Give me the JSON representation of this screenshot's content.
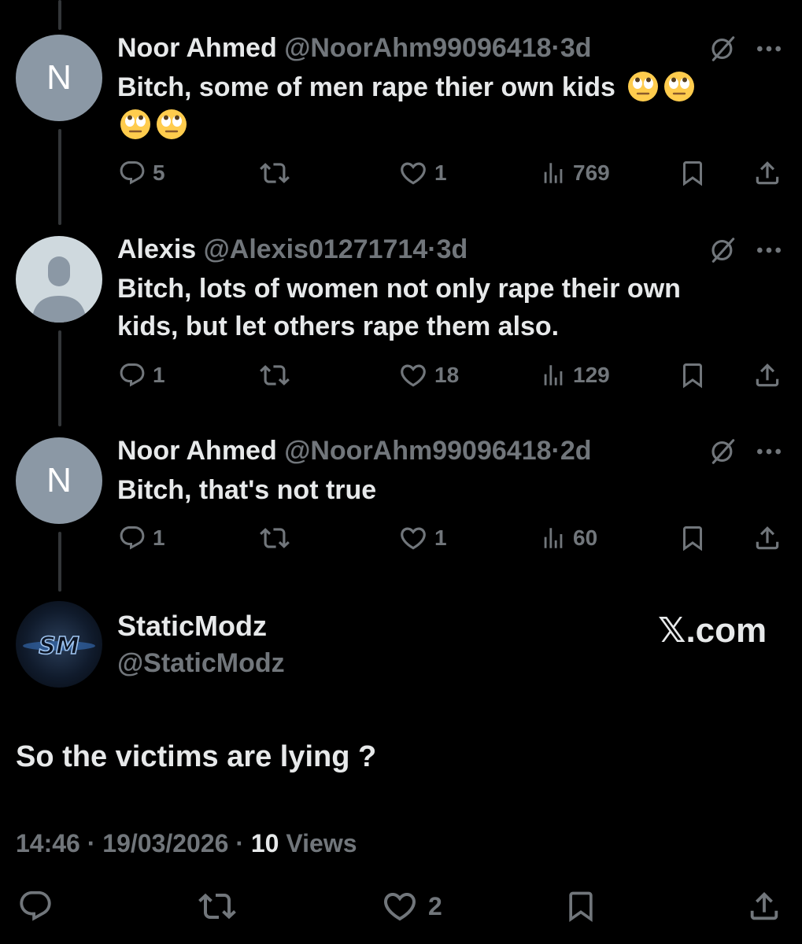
{
  "replies": [
    {
      "avatar_letter": "N",
      "name": "Noor Ahmed",
      "handle": "@NoorAhm99096418",
      "age": "3d",
      "text": "Bitch, some of men rape thier own kids",
      "emoji": [
        "face-with-rolling-eyes",
        "face-with-rolling-eyes",
        "face-with-rolling-eyes",
        "face-with-rolling-eyes"
      ],
      "replies_count": "5",
      "likes": "1",
      "views": "769"
    },
    {
      "avatar_letter": "",
      "name": "Alexis",
      "handle": "@Alexis01271714",
      "age": "3d",
      "text_line1": "Bitch, lots of women not only rape their own",
      "text_line2": "kids, but let others rape them also.",
      "replies_count": "1",
      "likes": "18",
      "views": "129"
    },
    {
      "avatar_letter": "N",
      "name": "Noor Ahmed",
      "handle": "@NoorAhm99096418",
      "age": "2d",
      "text": "Bitch, that's not true",
      "replies_count": "1",
      "likes": "1",
      "views": "60"
    }
  ],
  "main_post": {
    "avatar_text": "SM",
    "name": "StaticModz",
    "handle": "@StaticModz",
    "brand": "𝕏.com",
    "text": "So the victims are lying ?",
    "time": "14:46",
    "date": "19/03/2026",
    "views_count": "10",
    "views_label": "Views",
    "likes": "2"
  },
  "separator": "·",
  "icons": {
    "reply": "reply-icon",
    "repost": "repost-icon",
    "like": "heart-icon",
    "views": "views-icon",
    "bookmark": "bookmark-icon",
    "share": "share-icon",
    "grok": "grok-icon",
    "more": "more-icon"
  },
  "colors": {
    "background": "#000000",
    "text": "#e7e9ea",
    "muted": "#71767b",
    "thread_line": "#333639",
    "avatar_letter_bg": "#8b98a5"
  }
}
